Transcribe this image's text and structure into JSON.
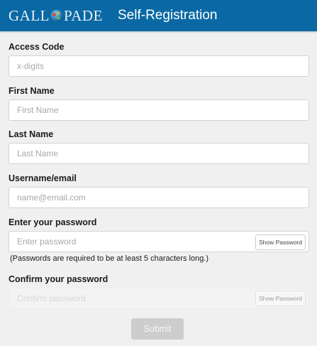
{
  "header": {
    "logo_left": "GALL",
    "logo_right": "PADE",
    "title": "Self-Registration"
  },
  "form": {
    "access_code": {
      "label": "Access Code",
      "placeholder": "x-digits",
      "value": ""
    },
    "first_name": {
      "label": "First Name",
      "placeholder": "First Name",
      "value": ""
    },
    "last_name": {
      "label": "Last Name",
      "placeholder": "Last Name",
      "value": ""
    },
    "username": {
      "label": "Username/email",
      "placeholder": "name@email.com",
      "value": ""
    },
    "password": {
      "label": "Enter your password",
      "placeholder": "Enter password",
      "value": "",
      "show_label": "Show Password",
      "hint": "(Passwords are required to be at least 5 characters long.)"
    },
    "confirm_password": {
      "label": "Confirm your password",
      "placeholder": "Confirm password",
      "value": "",
      "show_label": "Show Password"
    },
    "submit_label": "Submit"
  },
  "colors": {
    "header_bg": "#0a69a4",
    "page_bg": "#f0f0f0",
    "submit_disabled": "#cdcdcd"
  },
  "icons": {
    "logo_globe": "globe-icon"
  }
}
